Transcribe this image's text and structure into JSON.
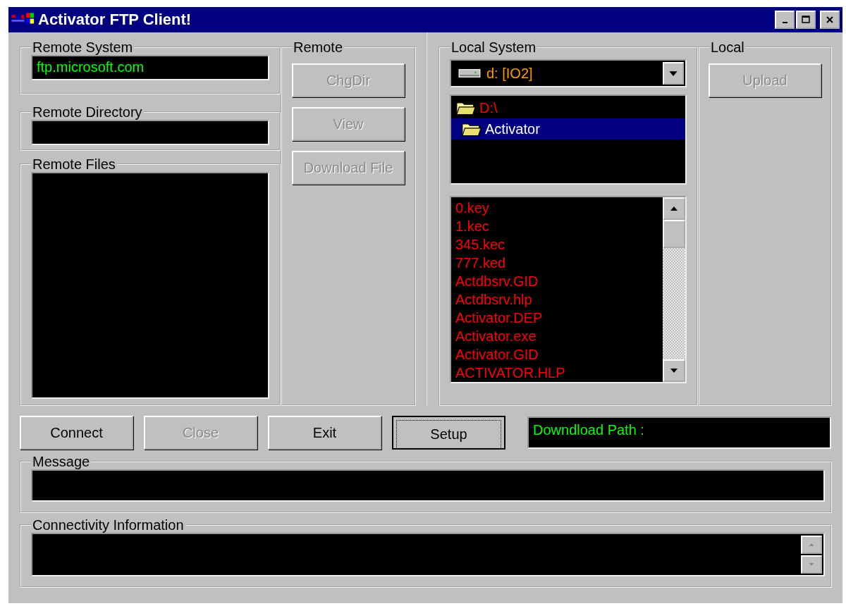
{
  "window": {
    "title": "Activator FTP Client!"
  },
  "remote": {
    "system_label": "Remote System",
    "system_value": "ftp.microsoft.com",
    "directory_label": "Remote Directory",
    "files_label": "Remote Files"
  },
  "remote_actions": {
    "title": "Remote",
    "buttons": [
      {
        "label": "ChgDir",
        "disabled": true
      },
      {
        "label": "View",
        "disabled": true
      },
      {
        "label": "Download File",
        "disabled": true
      }
    ]
  },
  "local": {
    "title": "Local System",
    "drive": "d: [IO2]",
    "folders": [
      {
        "name": "D:\\",
        "selected": false
      },
      {
        "name": "Activator",
        "selected": true
      }
    ],
    "files": [
      "0.key",
      "1.kec",
      "345.kec",
      "777.ked",
      "Actdbsrv.GID",
      "Actdbsrv.hlp",
      "Activator.DEP",
      "Activator.exe",
      "Activator.GID",
      "ACTIVATOR.HLP"
    ]
  },
  "local_actions": {
    "title": "Local",
    "buttons": [
      {
        "label": "Upload",
        "disabled": true
      }
    ]
  },
  "buttons": [
    {
      "label": "Connect",
      "disabled": false,
      "focused": false
    },
    {
      "label": "Close",
      "disabled": true,
      "focused": false
    },
    {
      "label": "Exit",
      "disabled": false,
      "focused": false
    },
    {
      "label": "Setup",
      "disabled": false,
      "focused": true
    }
  ],
  "download_path": "Downdload Path :",
  "message": {
    "title": "Message"
  },
  "connectivity": {
    "title": "Connectivity Information"
  }
}
